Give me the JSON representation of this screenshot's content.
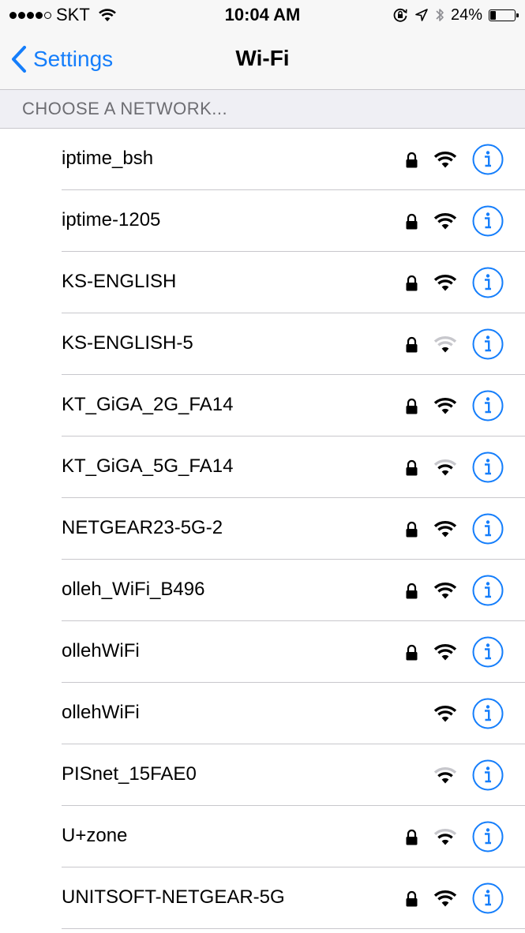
{
  "status_bar": {
    "carrier": "SKT",
    "time": "10:04 AM",
    "battery_percent": "24%",
    "battery_level": 0.24,
    "signal_bars_filled": 4,
    "signal_bars_total": 5,
    "icons": [
      "wifi-icon",
      "orientation-lock-icon",
      "location-icon",
      "bluetooth-icon",
      "battery-icon"
    ]
  },
  "nav": {
    "back_label": "Settings",
    "title": "Wi-Fi"
  },
  "section_header": "CHOOSE A NETWORK...",
  "accent_color": "#157efb",
  "networks": [
    {
      "name": "iptime_bsh",
      "secured": true,
      "signal": "strong"
    },
    {
      "name": "iptime-1205",
      "secured": true,
      "signal": "strong"
    },
    {
      "name": "KS-ENGLISH",
      "secured": true,
      "signal": "strong"
    },
    {
      "name": "KS-ENGLISH-5",
      "secured": true,
      "signal": "weak"
    },
    {
      "name": "KT_GiGA_2G_FA14",
      "secured": true,
      "signal": "strong"
    },
    {
      "name": "KT_GiGA_5G_FA14",
      "secured": true,
      "signal": "medium"
    },
    {
      "name": "NETGEAR23-5G-2",
      "secured": true,
      "signal": "strong"
    },
    {
      "name": "olleh_WiFi_B496",
      "secured": true,
      "signal": "strong"
    },
    {
      "name": "ollehWiFi",
      "secured": true,
      "signal": "strong"
    },
    {
      "name": "ollehWiFi",
      "secured": false,
      "signal": "strong"
    },
    {
      "name": "PISnet_15FAE0",
      "secured": false,
      "signal": "medium"
    },
    {
      "name": "U+zone",
      "secured": true,
      "signal": "medium"
    },
    {
      "name": "UNITSOFT-NETGEAR-5G",
      "secured": true,
      "signal": "strong"
    }
  ]
}
